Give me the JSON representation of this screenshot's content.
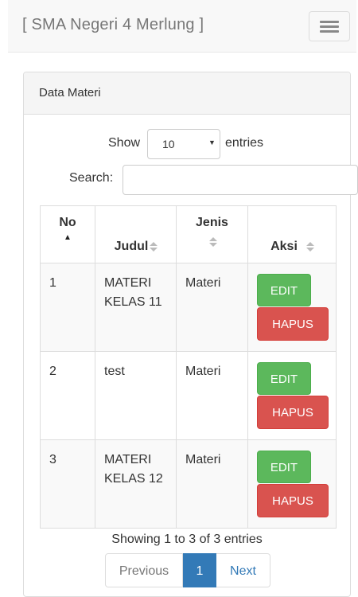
{
  "navbar": {
    "brand": "[ SMA Negeri 4 Merlung ]",
    "toggle_icon": "hamburger-menu-icon"
  },
  "panel": {
    "title": "Data Materi"
  },
  "controls": {
    "show_label": "Show",
    "entries_value": "10",
    "entries_label": "entries",
    "search_label": "Search:",
    "search_value": ""
  },
  "table": {
    "headers": {
      "no": "No",
      "judul": "Judul",
      "jenis": "Jenis",
      "aksi": "Aksi"
    },
    "rows": [
      {
        "no": "1",
        "judul": "MATERI KELAS 11",
        "jenis": "Materi",
        "edit": "EDIT",
        "hapus": "HAPUS"
      },
      {
        "no": "2",
        "judul": "test",
        "jenis": "Materi",
        "edit": "EDIT",
        "hapus": "HAPUS"
      },
      {
        "no": "3",
        "judul": "MATERI KELAS 12",
        "jenis": "Materi",
        "edit": "EDIT",
        "hapus": "HAPUS"
      }
    ]
  },
  "footer": {
    "info": "Showing 1 to 3 of 3 entries",
    "pagination": {
      "previous": "Previous",
      "current": "1",
      "next": "Next"
    }
  },
  "colors": {
    "edit": "#5cb85c",
    "hapus": "#d9534f",
    "active_page": "#337ab7"
  }
}
